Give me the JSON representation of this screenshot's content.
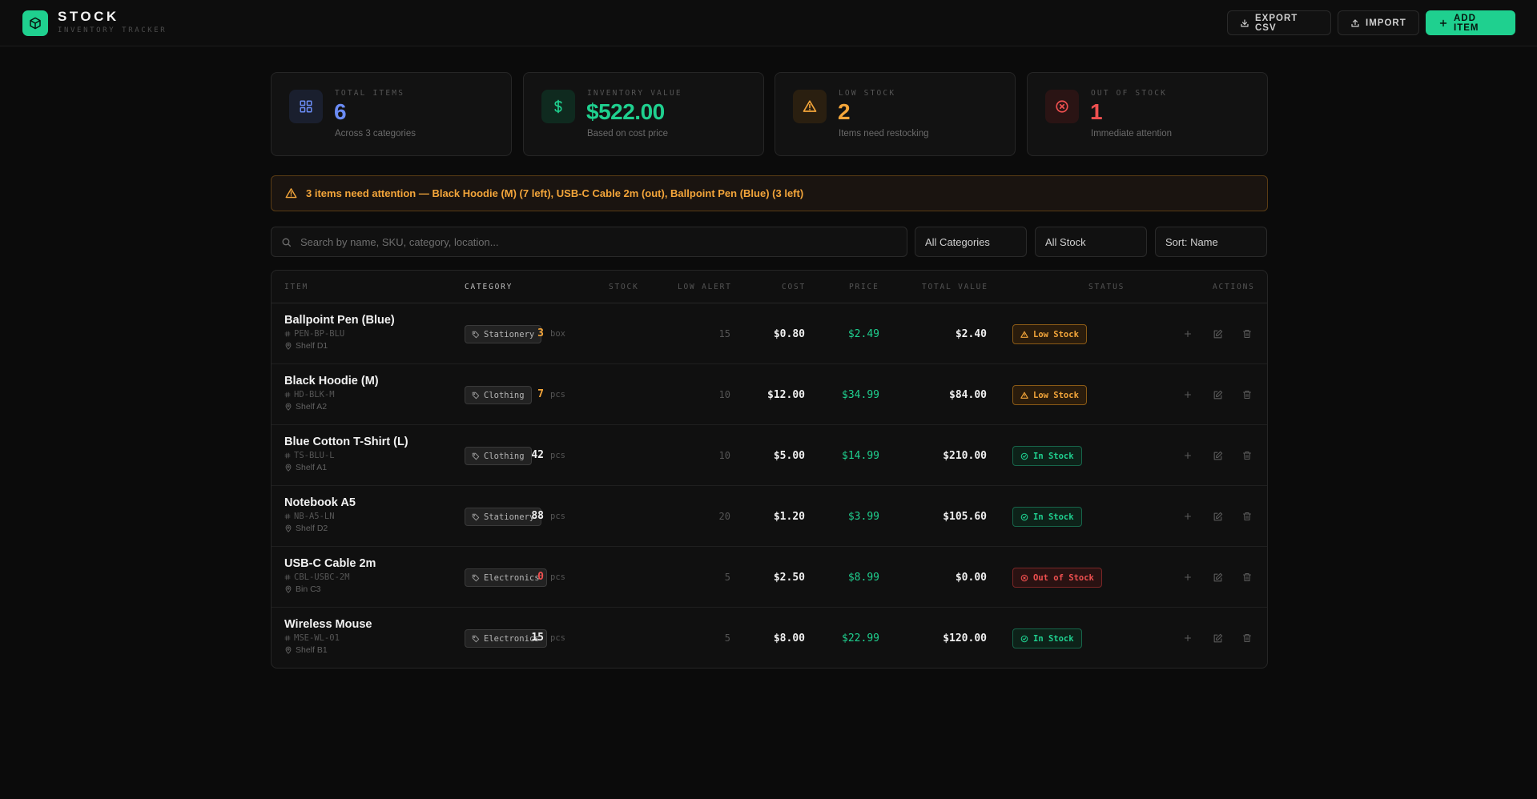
{
  "app": {
    "title": "STOCK",
    "subtitle": "INVENTORY TRACKER"
  },
  "header": {
    "export_label": "EXPORT CSV",
    "import_label": "IMPORT",
    "add_label": "ADD ITEM"
  },
  "stats": {
    "total_items": {
      "label": "TOTAL ITEMS",
      "value": "6",
      "sub": "Across 3 categories",
      "color": "#6b8cf5"
    },
    "inventory_value": {
      "label": "INVENTORY VALUE",
      "value": "$522.00",
      "sub": "Based on cost price",
      "color": "#1fd08f"
    },
    "low_stock": {
      "label": "LOW STOCK",
      "value": "2",
      "sub": "Items need restocking",
      "color": "#f3a53a"
    },
    "out_of_stock": {
      "label": "OUT OF STOCK",
      "value": "1",
      "sub": "Immediate attention",
      "color": "#ef5050"
    }
  },
  "alert": {
    "text": "3 items need attention — Black Hoodie (M) (7 left), USB-C Cable 2m (out), Ballpoint Pen (Blue) (3 left)"
  },
  "filters": {
    "search_placeholder": "Search by name, SKU, category, location...",
    "category": "All Categories",
    "stock": "All Stock",
    "sort": "Sort: Name"
  },
  "table": {
    "headers": {
      "item": "ITEM",
      "category": "CATEGORY",
      "stock": "STOCK",
      "low_alert": "LOW ALERT",
      "cost": "COST",
      "price": "PRICE",
      "total_value": "TOTAL VALUE",
      "status": "STATUS",
      "actions": "ACTIONS"
    },
    "rows": [
      {
        "name": "Ballpoint Pen (Blue)",
        "sku": "PEN-BP-BLU",
        "location": "Shelf D1",
        "category": "Stationery",
        "qty": "3",
        "unit": "box",
        "low_alert": "15",
        "cost": "$0.80",
        "price": "$2.49",
        "total": "$2.40",
        "status": "Low Stock",
        "status_type": "low"
      },
      {
        "name": "Black Hoodie (M)",
        "sku": "HD-BLK-M",
        "location": "Shelf A2",
        "category": "Clothing",
        "qty": "7",
        "unit": "pcs",
        "low_alert": "10",
        "cost": "$12.00",
        "price": "$34.99",
        "total": "$84.00",
        "status": "Low Stock",
        "status_type": "low"
      },
      {
        "name": "Blue Cotton T-Shirt (L)",
        "sku": "TS-BLU-L",
        "location": "Shelf A1",
        "category": "Clothing",
        "qty": "42",
        "unit": "pcs",
        "low_alert": "10",
        "cost": "$5.00",
        "price": "$14.99",
        "total": "$210.00",
        "status": "In Stock",
        "status_type": "in"
      },
      {
        "name": "Notebook A5",
        "sku": "NB-A5-LN",
        "location": "Shelf D2",
        "category": "Stationery",
        "qty": "88",
        "unit": "pcs",
        "low_alert": "20",
        "cost": "$1.20",
        "price": "$3.99",
        "total": "$105.60",
        "status": "In Stock",
        "status_type": "in"
      },
      {
        "name": "USB-C Cable 2m",
        "sku": "CBL-USBC-2M",
        "location": "Bin C3",
        "category": "Electronics",
        "qty": "0",
        "unit": "pcs",
        "low_alert": "5",
        "cost": "$2.50",
        "price": "$8.99",
        "total": "$0.00",
        "status": "Out of Stock",
        "status_type": "out"
      },
      {
        "name": "Wireless Mouse",
        "sku": "MSE-WL-01",
        "location": "Shelf B1",
        "category": "Electronics",
        "qty": "15",
        "unit": "pcs",
        "low_alert": "5",
        "cost": "$8.00",
        "price": "$22.99",
        "total": "$120.00",
        "status": "In Stock",
        "status_type": "in"
      }
    ]
  },
  "colors": {
    "accent": "#1fd08f",
    "low": "#f3a53a",
    "out": "#ef5050",
    "in": "#1fd08f",
    "normal_qty": "#f0f0f0"
  },
  "icons": {
    "logo": "cube-icon",
    "export": "download-icon",
    "import": "upload-icon",
    "add": "plus-icon",
    "total_items": "grid-icon",
    "inventory_value": "dollar-icon",
    "low_stock": "warning-icon",
    "out_of_stock": "x-circle-icon",
    "search": "search-icon",
    "sku": "hash-icon",
    "location": "map-pin-icon",
    "category": "tag-icon",
    "row_add": "plus-icon",
    "row_edit": "edit-icon",
    "row_delete": "trash-icon"
  }
}
